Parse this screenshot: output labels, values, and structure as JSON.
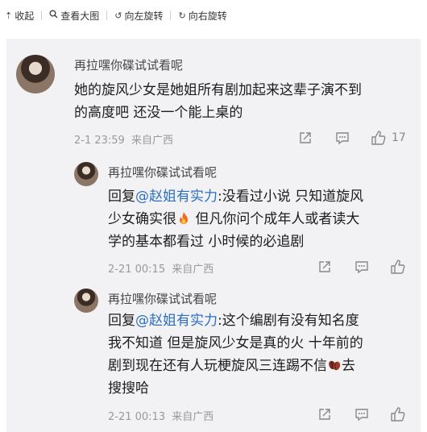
{
  "toolbar": {
    "collapse": "收起",
    "view_large": "查看大图",
    "rotate_left": "向左旋转",
    "rotate_right": "向右旋转"
  },
  "comments": [
    {
      "username": "再拉嘿你碟试试看呢",
      "lines": [
        "她的旋风少女是她姐所有剧加起来这辈子演不到",
        "的高度吧 还没一个能上桌的"
      ],
      "time": "2-1 23:59",
      "location": "来自广西",
      "likes": "17"
    }
  ],
  "replies": [
    {
      "username": "再拉嘿你碟试试看呢",
      "prefix": "回复",
      "mention": "@赵姐有实力",
      "line1": ":没看过小说 只知道旋风",
      "line2a": "少女确实很",
      "line2b": " 但凡你问个成年人或者读大",
      "line3": "学的基本都看过 小时候的必追剧",
      "emoji": "fire",
      "time": "2-21 00:15",
      "location": "来自广西"
    },
    {
      "username": "再拉嘿你碟试试看呢",
      "prefix": "回复",
      "mention": "@赵姐有实力",
      "line1": ":这个编剧有没有知名度",
      "line2": "我不知道 但是旋风少女是真的火 十年前的",
      "line3a": "剧到现在还有人玩梗旋风三连踢不信",
      "line3b": "去",
      "line4": "搜搜哈",
      "emoji": "beans",
      "time": "2-21 00:13",
      "location": "来自广西"
    }
  ],
  "colors": {
    "mention": "#2d6fbf",
    "panel_bg": "#f2f2f5",
    "meta": "#999999"
  }
}
